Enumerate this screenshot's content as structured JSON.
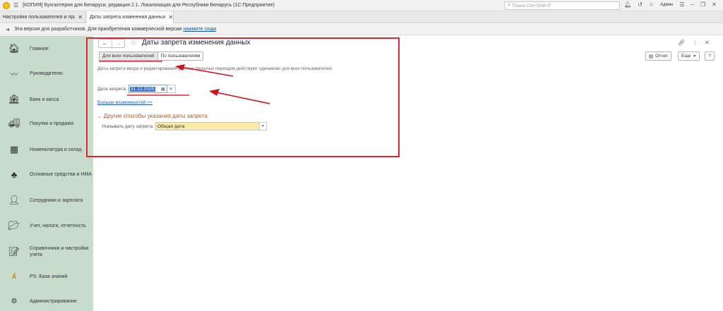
{
  "window": {
    "title": "[КОПИЯ] Бухгалтерия для Беларуси, редакция 2.1. Локализация для Республики Беларусь   (1С:Предприятие)",
    "search_placeholder": "Поиск Ctrl+Shift+F",
    "user": "Админ"
  },
  "tabs": [
    {
      "label": "Настройки пользователей и прав"
    },
    {
      "label": "Даты запрета изменения данных"
    }
  ],
  "notice": {
    "text": "Эта версия для разработчиков. Для приобретения коммерческой версии",
    "link": "нажмите сюда"
  },
  "sidebar": {
    "items": [
      {
        "label": "Главное",
        "icon": "home-icon"
      },
      {
        "label": "Руководителю",
        "icon": "trend-icon"
      },
      {
        "label": "Банк и касса",
        "icon": "bank-icon"
      },
      {
        "label": "Покупки и продажи",
        "icon": "truck-icon"
      },
      {
        "label": "Номенклатура и склад",
        "icon": "warehouse-icon"
      },
      {
        "label": "Основные средства и НМА",
        "icon": "assets-icon"
      },
      {
        "label": "Сотрудники и зарплата",
        "icon": "people-icon"
      },
      {
        "label": "Учет, налоги, отчетность",
        "icon": "folder-icon"
      },
      {
        "label": "Справочники и настройки учета",
        "icon": "document-icon"
      },
      {
        "label": "PS: База знаний",
        "icon": "knowledge-icon"
      },
      {
        "label": "Администрирование",
        "icon": "gear-icon"
      }
    ]
  },
  "form": {
    "title": "Даты запрета изменения данных",
    "segment_all": "Для всех пользователей",
    "segment_by_user": "По пользователям",
    "description": "Даты запрета ввода и редактирования данных прошлых периодов действуют одинаково для всех пользователей.",
    "date_label": "Дата запрета:",
    "date_value": "31.12.2025",
    "more_link": "Больше возможностей >>",
    "other_section": "Другие способы указания даты запрета",
    "specify_label": "Указывать дату запрета:",
    "specify_value": "Общая дата",
    "report_button": "Отчет",
    "more_button": "Еще",
    "help_button": "?"
  },
  "colors": {
    "sidebar_bg": "#c8dccb",
    "annotation_red": "#e0252f",
    "selection_blue": "#3b6fd1",
    "select_bg": "#fbe9a9",
    "section_title": "#b15a2a"
  }
}
